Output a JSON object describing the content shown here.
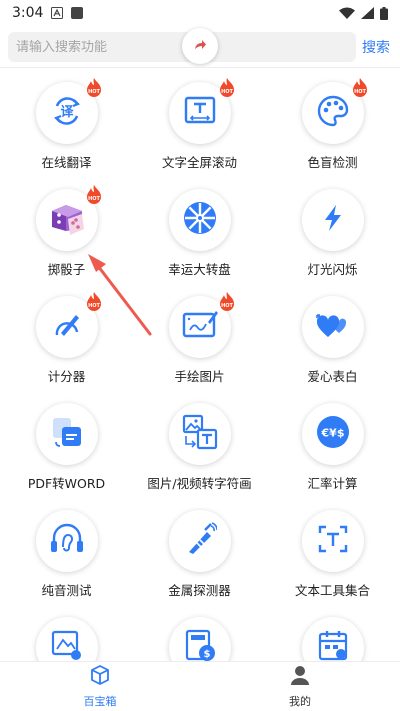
{
  "status_bar": {
    "time": "3:04"
  },
  "search": {
    "placeholder": "请输入搜索功能",
    "button_label": "搜索"
  },
  "tools": [
    {
      "label": "在线翻译",
      "hot": true,
      "icon": "translate-icon"
    },
    {
      "label": "文字全屏滚动",
      "hot": true,
      "icon": "fullscreen-text-icon"
    },
    {
      "label": "色盲检测",
      "hot": true,
      "icon": "palette-icon"
    },
    {
      "label": "掷骰子",
      "hot": true,
      "icon": "dice-icon"
    },
    {
      "label": "幸运大转盘",
      "hot": false,
      "icon": "wheel-icon"
    },
    {
      "label": "灯光闪烁",
      "hot": false,
      "icon": "lightning-icon"
    },
    {
      "label": "计分器",
      "hot": true,
      "icon": "scorer-icon"
    },
    {
      "label": "手绘图片",
      "hot": true,
      "icon": "drawing-tablet-icon"
    },
    {
      "label": "爱心表白",
      "hot": false,
      "icon": "hearts-icon"
    },
    {
      "label": "PDF转WORD",
      "hot": false,
      "icon": "pdf-convert-icon"
    },
    {
      "label": "图片/视频转字符画",
      "hot": false,
      "icon": "image-to-text-icon"
    },
    {
      "label": "汇率计算",
      "hot": false,
      "icon": "currency-icon"
    },
    {
      "label": "纯音测试",
      "hot": false,
      "icon": "ear-headphones-icon"
    },
    {
      "label": "金属探测器",
      "hot": false,
      "icon": "metal-detector-icon"
    },
    {
      "label": "文本工具集合",
      "hot": false,
      "icon": "text-tools-icon"
    },
    {
      "label": "",
      "hot": false,
      "icon": "image-edit-icon"
    },
    {
      "label": "",
      "hot": false,
      "icon": "calculator-money-icon"
    },
    {
      "label": "",
      "hot": false,
      "icon": "calendar-icon"
    }
  ],
  "tab_bar": {
    "tabs": [
      {
        "label": "百宝箱",
        "active": true,
        "icon": "box-icon"
      },
      {
        "label": "我的",
        "active": false,
        "icon": "user-icon"
      }
    ]
  },
  "colors": {
    "accent": "#2f7cf6",
    "hot_badge": "#f04a2a",
    "annotation_arrow": "#ef5a50"
  }
}
